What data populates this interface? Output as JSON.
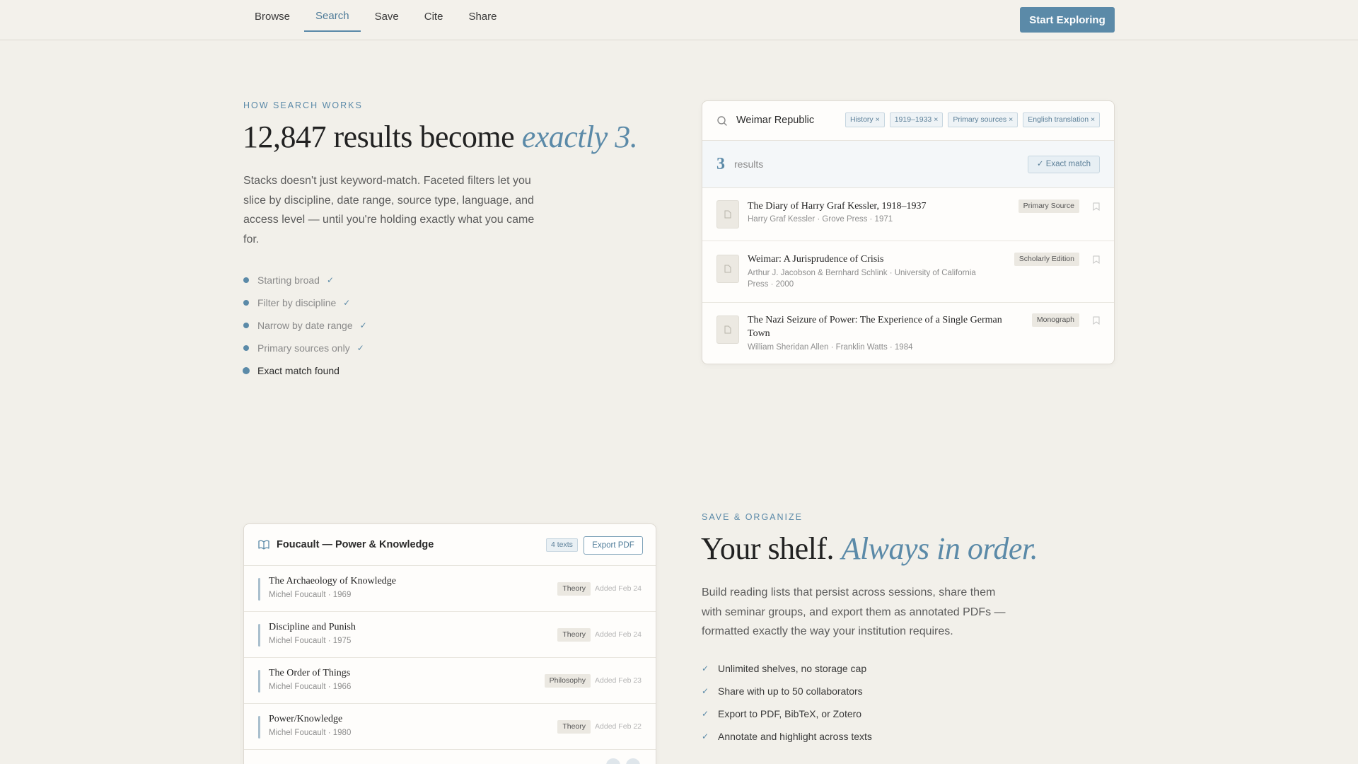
{
  "nav": {
    "links": [
      "Browse",
      "Search",
      "Save",
      "Cite",
      "Share"
    ],
    "active": "Search",
    "cta_label": "Start Exploring"
  },
  "search_section": {
    "eyebrow": "HOW SEARCH WORKS",
    "headline_plain": "12,847 results become",
    "headline_accent": "exactly 3.",
    "lede": "Stacks doesn't just keyword-match. Faceted filters let you slice by discipline, date range, source type, language, and access level — until you're holding exactly what you came for.",
    "steps": [
      {
        "label": "Starting broad",
        "done": true
      },
      {
        "label": "Filter by discipline",
        "done": true
      },
      {
        "label": "Narrow by date range",
        "done": true
      },
      {
        "label": "Primary sources only",
        "done": true
      },
      {
        "label": "Exact match found",
        "done": false
      }
    ]
  },
  "search_card": {
    "query": "Weimar Republic",
    "chips": [
      "History ×",
      "1919–1933 ×",
      "Primary sources ×",
      "English translation ×"
    ],
    "result_count": "3",
    "result_label": "results",
    "exact_match_label": "✓ Exact match",
    "results": [
      {
        "title": "The Diary of Harry Graf Kessler, 1918–1937",
        "meta": "Harry Graf Kessler · Grove Press · 1971",
        "badge": "Primary Source"
      },
      {
        "title": "Weimar: A Jurisprudence of Crisis",
        "meta_line1": "Arthur J. Jacobson & Bernhard Schlink · University of California",
        "meta_line2": "Press · 2000",
        "badge": "Scholarly Edition"
      },
      {
        "title_line1": "The Nazi Seizure of Power: The Experience of a Single German",
        "title_line2": "Town",
        "meta": "William Sheridan Allen · Franklin Watts · 1984",
        "badge": "Monograph"
      }
    ]
  },
  "shelf_section": {
    "eyebrow": "SAVE & ORGANIZE",
    "headline_plain": "Your shelf.",
    "headline_accent": "Always in order.",
    "lede": "Build reading lists that persist across sessions, share them with seminar groups, and export them as annotated PDFs — formatted exactly the way your institution requires.",
    "features": [
      "Unlimited shelves, no storage cap",
      "Share with up to 50 collaborators",
      "Export to PDF, BibTeX, or Zotero",
      "Annotate and highlight across texts"
    ]
  },
  "shelf_card": {
    "title": "Foucault — Power & Knowledge",
    "count_badge": "4 texts",
    "export_label": "Export PDF",
    "rows": [
      {
        "title": "The Archaeology of Knowledge",
        "meta": "Michel Foucault · 1969",
        "tag": "Theory",
        "added": "Added Feb 24"
      },
      {
        "title": "Discipline and Punish",
        "meta": "Michel Foucault · 1975",
        "tag": "Theory",
        "added": "Added Feb 24"
      },
      {
        "title": "The Order of Things",
        "meta": "Michel Foucault · 1966",
        "tag": "Philosophy",
        "added": "Added Feb 23"
      },
      {
        "title": "Power/Knowledge",
        "meta": "Michel Foucault · 1980",
        "tag": "Theory",
        "added": "Added Feb 22"
      }
    ]
  },
  "colors": {
    "accent": "#5b8aa8",
    "background": "#f2f0ea",
    "card": "#fefdfb"
  }
}
